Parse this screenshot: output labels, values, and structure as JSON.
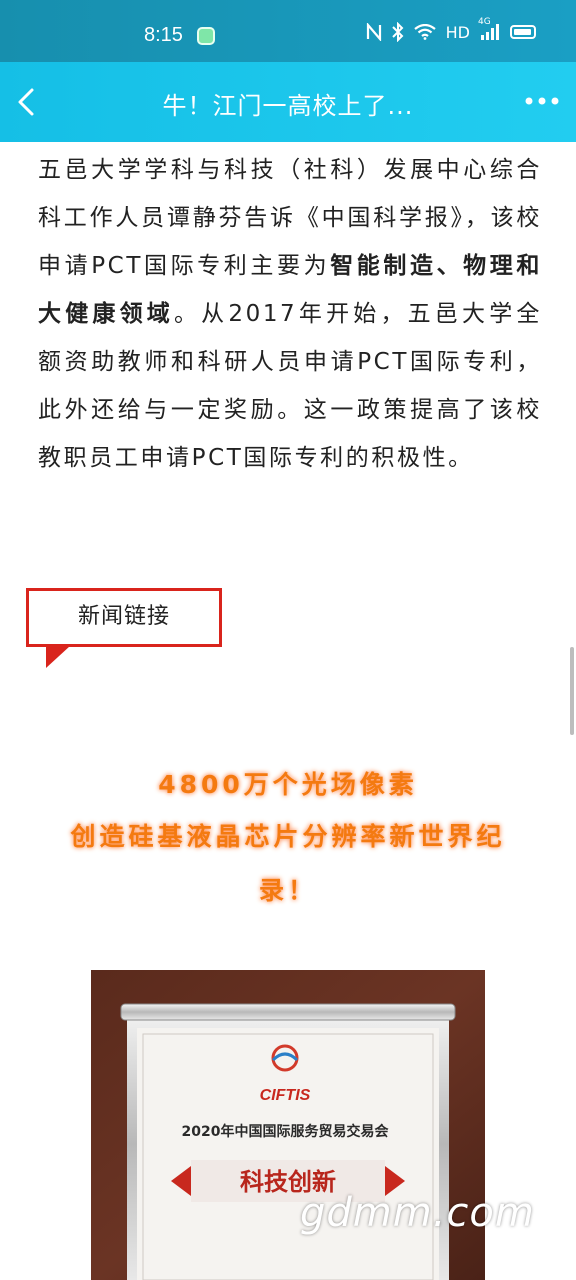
{
  "status_bar": {
    "time": "8:15",
    "net_label": "HD",
    "signal_label": "4G",
    "icons": [
      "app-notification-icon",
      "nfc-icon",
      "bluetooth-icon",
      "wifi-icon",
      "hd-icon",
      "cell-signal-icon",
      "battery-icon"
    ]
  },
  "nav": {
    "title": "牛！江门一高校上了...",
    "back_icon": "back-arrow-icon",
    "more_icon": "more-dots-icon"
  },
  "article": {
    "para_before_bold": "五邑大学学科与科技（社科）发展中心综合科工作人员谭静芬告诉《中国科学报》，该校申请PCT国际专利主要为",
    "para_bold": "智能制造、物理和大健康领域",
    "para_after_bold": "。从2017年开始，五邑大学全额资助教师和科研人员申请PCT国际专利，此外还给与一定奖励。这一政策提高了该校教职员工申请PCT国际专利的积极性。"
  },
  "news_link": {
    "label": "新闻链接"
  },
  "headline": {
    "line1": "4800万个光场像素",
    "line2": "创造硅基液晶芯片分辨率新世界纪",
    "line3": "录！"
  },
  "award_photo": {
    "logo_text": "CIFTIS",
    "event_text": "2020年中国国际服务贸易交易会",
    "award_text": "科技创新"
  },
  "watermark": {
    "text": "gdmm.com"
  },
  "colors": {
    "status_bar": "#178fae",
    "nav_bar": "#15bfe6",
    "headline_orange": "#f47a10",
    "tag_red": "#d9241c",
    "award_red": "#c8281e"
  }
}
